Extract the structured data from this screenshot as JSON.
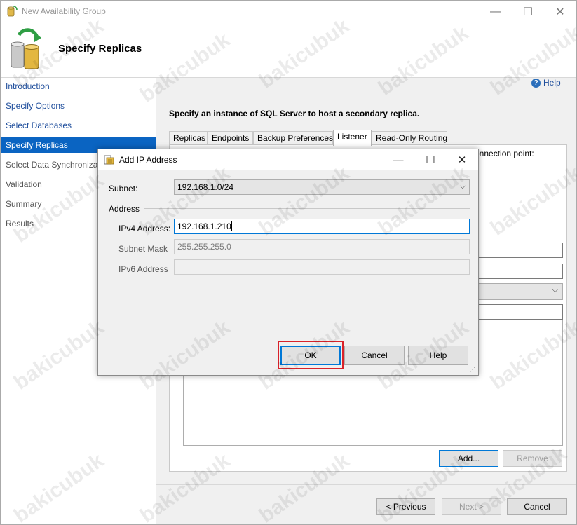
{
  "window": {
    "title": "New Availability Group",
    "page_title": "Specify Replicas",
    "minimize_glyph": "—",
    "maximize_glyph": "☐",
    "close_glyph": "✕"
  },
  "sidebar": {
    "items": [
      {
        "label": "Introduction",
        "state": "link"
      },
      {
        "label": "Specify Options",
        "state": "link"
      },
      {
        "label": "Select Databases",
        "state": "link"
      },
      {
        "label": "Specify Replicas",
        "state": "active"
      },
      {
        "label": "Select Data Synchronization",
        "state": "disabled"
      },
      {
        "label": "Validation",
        "state": "disabled"
      },
      {
        "label": "Summary",
        "state": "disabled"
      },
      {
        "label": "Results",
        "state": "disabled"
      }
    ]
  },
  "help": {
    "label": "Help",
    "glyph": "?"
  },
  "main": {
    "instruction": "Specify an instance of SQL Server to host a secondary replica.",
    "tabs": [
      "Replicas",
      "Endpoints",
      "Backup Preferences",
      "Listener",
      "Read-Only Routing"
    ],
    "active_tab": "Listener",
    "visible_text_fragment": "onnection point:",
    "add_button": "Add...",
    "remove_button": "Remove"
  },
  "footer": {
    "previous": "< Previous",
    "next": "Next >",
    "cancel": "Cancel"
  },
  "dialog": {
    "title": "Add IP Address",
    "subnet_label": "Subnet:",
    "subnet_value": "192.168.1.0/24",
    "address_group": "Address",
    "ipv4_label": "IPv4 Address:",
    "ipv4_value": "192.168.1.210",
    "subnet_mask_label": "Subnet Mask",
    "subnet_mask_value": "255.255.255.0",
    "ipv6_label": "IPv6 Address",
    "ipv6_value": "",
    "ok": "OK",
    "cancel": "Cancel",
    "help": "Help"
  },
  "watermark": "bakicubuk",
  "colors": {
    "active_nav": "#0a64c2",
    "link": "#1f4e9c",
    "highlight": "#d9222a"
  }
}
